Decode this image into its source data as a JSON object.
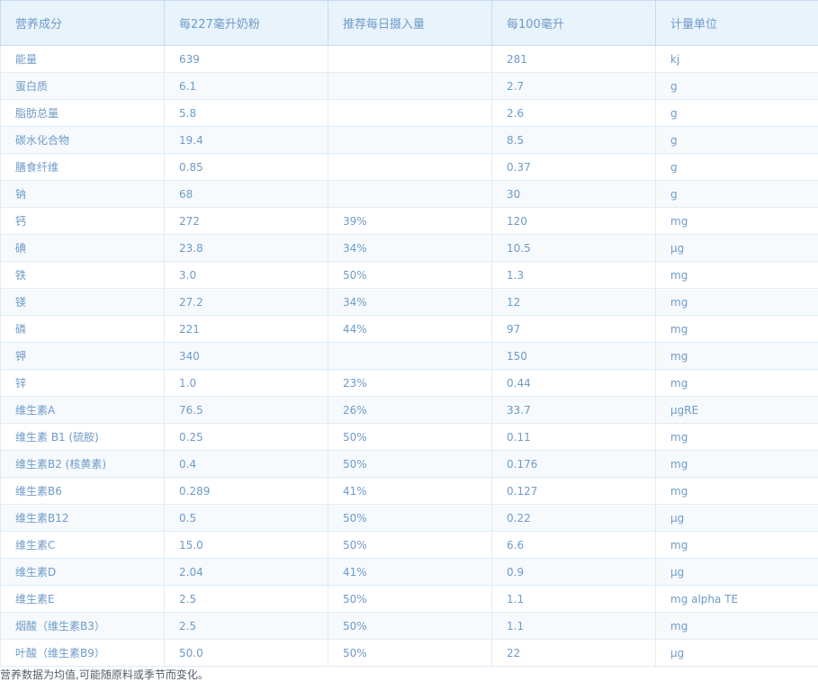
{
  "table": {
    "headers": [
      "营养成分",
      "每227毫升奶粉",
      "推荐每日摄入量",
      "每100毫升",
      "计量单位"
    ],
    "rows": [
      [
        "能量",
        "639",
        "",
        "281",
        "kj"
      ],
      [
        "蛋白质",
        "6.1",
        "",
        "2.7",
        "g"
      ],
      [
        "脂肪总量",
        "5.8",
        "",
        "2.6",
        "g"
      ],
      [
        "碳水化合物",
        "19.4",
        "",
        "8.5",
        "g"
      ],
      [
        "膳食纤维",
        "0.85",
        "",
        "0.37",
        "g"
      ],
      [
        "钠",
        "68",
        "",
        "30",
        "g"
      ],
      [
        "钙",
        "272",
        "39%",
        "120",
        "mg"
      ],
      [
        "碘",
        "23.8",
        "34%",
        "10.5",
        "μg"
      ],
      [
        "铁",
        "3.0",
        "50%",
        "1.3",
        "mg"
      ],
      [
        "镁",
        "27.2",
        "34%",
        "12",
        "mg"
      ],
      [
        "磷",
        "221",
        "44%",
        "97",
        "mg"
      ],
      [
        "钾",
        "340",
        "",
        "150",
        "mg"
      ],
      [
        "锌",
        "1.0",
        "23%",
        "0.44",
        "mg"
      ],
      [
        "维生素A",
        "76.5",
        "26%",
        "33.7",
        "μgRE"
      ],
      [
        "维生素 B1 (硫胺)",
        "0.25",
        "50%",
        "0.11",
        "mg"
      ],
      [
        "维生素B2 (核黄素)",
        "0.4",
        "50%",
        "0.176",
        "mg"
      ],
      [
        "维生素B6",
        "0.289",
        "41%",
        "0.127",
        "mg"
      ],
      [
        "维生素B12",
        "0.5",
        "50%",
        "0.22",
        "μg"
      ],
      [
        "维生素C",
        "15.0",
        "50%",
        "6.6",
        "mg"
      ],
      [
        "维生素D",
        "2.04",
        "41%",
        "0.9",
        "μg"
      ],
      [
        "维生素E",
        "2.5",
        "50%",
        "1.1",
        "mg alpha TE"
      ],
      [
        "烟酸（维生素B3）",
        "2.5",
        "50%",
        "1.1",
        "mg"
      ],
      [
        "叶酸（维生素B9）",
        "50.0",
        "50%",
        "22",
        "μg"
      ]
    ]
  },
  "footnote": "营养数据为均值,可能随原料或季节而变化。",
  "colors": {
    "header_bg": "#e8f3fc",
    "text": "#6f9bc7",
    "row_alt_bg": "#f6fafd",
    "border": "#e0ecf6",
    "footnote_text": "#555f6b"
  }
}
